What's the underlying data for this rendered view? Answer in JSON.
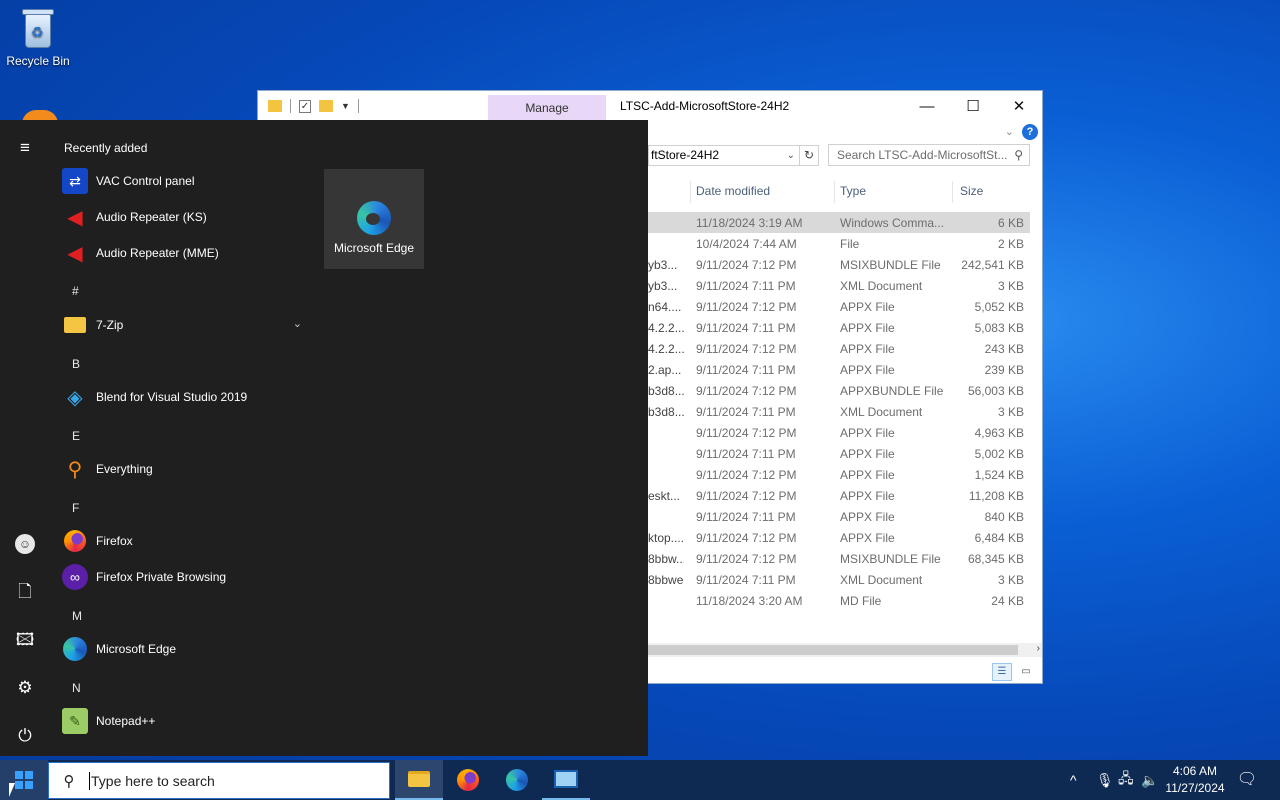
{
  "desktop": {
    "recycle_bin_label": "Recycle Bin"
  },
  "explorer": {
    "manage_tab": "Manage",
    "title": "LTSC-Add-MicrosoftStore-24H2",
    "address": "ftStore-24H2",
    "search_placeholder": "Search LTSC-Add-MicrosoftSt...",
    "columns": {
      "date": "Date modified",
      "type": "Type",
      "size": "Size"
    },
    "rows": [
      {
        "name": "",
        "date": "11/18/2024 3:19 AM",
        "type": "Windows Comma...",
        "size": "6 KB",
        "selected": true
      },
      {
        "name": "",
        "date": "10/4/2024 7:44 AM",
        "type": "File",
        "size": "2 KB"
      },
      {
        "name": "yb3...",
        "date": "9/11/2024 7:12 PM",
        "type": "MSIXBUNDLE File",
        "size": "242,541 KB"
      },
      {
        "name": "yb3...",
        "date": "9/11/2024 7:11 PM",
        "type": "XML Document",
        "size": "3 KB"
      },
      {
        "name": "n64....",
        "date": "9/11/2024 7:12 PM",
        "type": "APPX File",
        "size": "5,052 KB"
      },
      {
        "name": "4.2.2....",
        "date": "9/11/2024 7:11 PM",
        "type": "APPX File",
        "size": "5,083 KB"
      },
      {
        "name": "4.2.2....",
        "date": "9/11/2024 7:12 PM",
        "type": "APPX File",
        "size": "243 KB"
      },
      {
        "name": "2.ap...",
        "date": "9/11/2024 7:11 PM",
        "type": "APPX File",
        "size": "239 KB"
      },
      {
        "name": "b3d8...",
        "date": "9/11/2024 7:12 PM",
        "type": "APPXBUNDLE File",
        "size": "56,003 KB"
      },
      {
        "name": "b3d8...",
        "date": "9/11/2024 7:11 PM",
        "type": "XML Document",
        "size": "3 KB"
      },
      {
        "name": "",
        "date": "9/11/2024 7:12 PM",
        "type": "APPX File",
        "size": "4,963 KB"
      },
      {
        "name": "",
        "date": "9/11/2024 7:11 PM",
        "type": "APPX File",
        "size": "5,002 KB"
      },
      {
        "name": "",
        "date": "9/11/2024 7:12 PM",
        "type": "APPX File",
        "size": "1,524 KB"
      },
      {
        "name": "eskt...",
        "date": "9/11/2024 7:12 PM",
        "type": "APPX File",
        "size": "11,208 KB"
      },
      {
        "name": "",
        "date": "9/11/2024 7:11 PM",
        "type": "APPX File",
        "size": "840 KB"
      },
      {
        "name": "ktop....",
        "date": "9/11/2024 7:12 PM",
        "type": "APPX File",
        "size": "6,484 KB"
      },
      {
        "name": "8bbw...",
        "date": "9/11/2024 7:12 PM",
        "type": "MSIXBUNDLE File",
        "size": "68,345 KB"
      },
      {
        "name": "8bbwe",
        "date": "9/11/2024 7:11 PM",
        "type": "XML Document",
        "size": "3 KB"
      },
      {
        "name": "",
        "date": "11/18/2024 3:20 AM",
        "type": "MD File",
        "size": "24 KB"
      }
    ]
  },
  "start_menu": {
    "recently_added": "Recently added",
    "apps": [
      {
        "label": "VAC Control panel",
        "icon": "vac-icon"
      },
      {
        "label": "Audio Repeater (KS)",
        "icon": "audio-repeater-icon"
      },
      {
        "label": "Audio Repeater (MME)",
        "icon": "audio-repeater-icon"
      },
      {
        "label": "7-Zip",
        "icon": "folder-icon"
      },
      {
        "label": "Blend for Visual Studio 2019",
        "icon": "blend-icon"
      },
      {
        "label": "Everything",
        "icon": "everything-icon"
      },
      {
        "label": "Firefox",
        "icon": "firefox-icon"
      },
      {
        "label": "Firefox Private Browsing",
        "icon": "firefox-private-icon"
      },
      {
        "label": "Microsoft Edge",
        "icon": "edge-icon"
      },
      {
        "label": "Notepad++",
        "icon": "notepadpp-icon"
      }
    ],
    "letters": {
      "hash": "#",
      "b": "B",
      "e": "E",
      "f": "F",
      "m": "M",
      "n": "N"
    },
    "tile": {
      "label": "Microsoft Edge"
    }
  },
  "taskbar": {
    "search_placeholder": "Type here to search",
    "time": "4:06 AM",
    "date": "11/27/2024"
  }
}
